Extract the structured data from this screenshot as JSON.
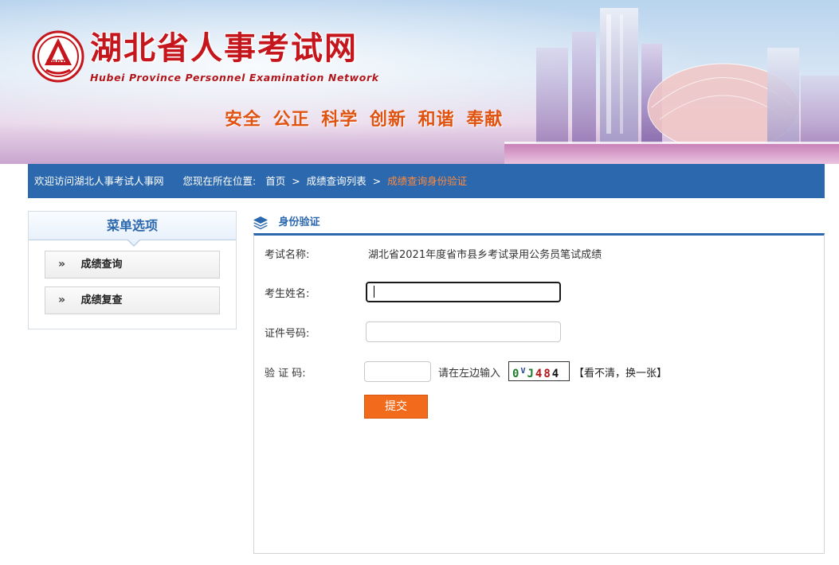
{
  "header": {
    "title": "湖北省人事考试网",
    "subtitle": "Hubei Province Personnel Examination Network",
    "logo_text": "HBPTA",
    "slogan": "安全 公正 科学 创新 和谐 奉献"
  },
  "navbar": {
    "welcome": "欢迎访问湖北人事考试人事网",
    "location_label": "您现在所在位置:",
    "breadcrumb": [
      {
        "label": "首页"
      },
      {
        "label": "成绩查询列表"
      },
      {
        "label": "成绩查询身份验证"
      }
    ],
    "separator": ">"
  },
  "sidebar": {
    "title": "菜单选项",
    "items": [
      {
        "label": "成绩查询",
        "chevron": "»"
      },
      {
        "label": "成绩复查",
        "chevron": "»"
      }
    ]
  },
  "main": {
    "section_title": "身份验证",
    "exam_name_label": "考试名称:",
    "exam_name_value": "湖北省2021年度省市县乡考试录用公务员笔试成绩",
    "name_label": "考生姓名:",
    "name_value": "",
    "id_label": "证件号码:",
    "id_value": "",
    "captcha_label": "验 证 码:",
    "captcha_value": "",
    "captcha_hint": "请在左边输入",
    "captcha_chars": [
      "0",
      "V",
      "J",
      "4",
      "8",
      "4"
    ],
    "captcha_refresh": "【看不清，换一张】",
    "submit_label": "提交"
  },
  "colors": {
    "brand_blue": "#2b68ad",
    "brand_red": "#c4161c",
    "submit_orange": "#f26b1d",
    "current_crumb": "#ff8a3d"
  }
}
